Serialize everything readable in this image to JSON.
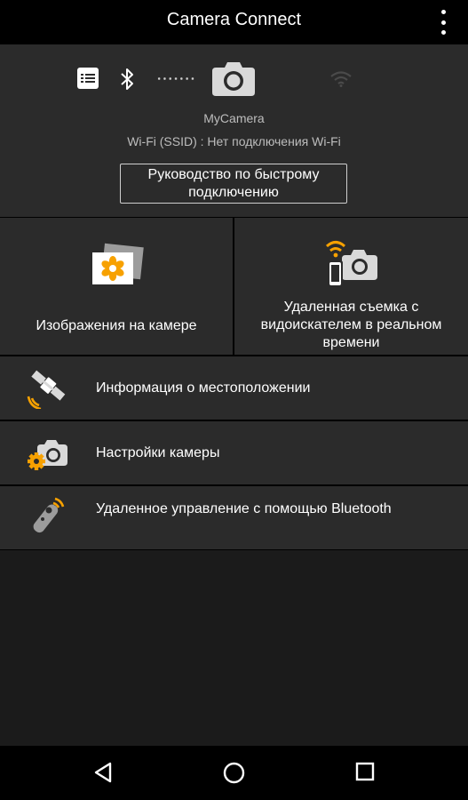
{
  "appbar": {
    "title": "Camera Connect",
    "menu_icon": "overflow-menu-icon"
  },
  "status": {
    "list_icon": "list-icon",
    "bluetooth_icon": "bluetooth-icon",
    "connection_dots_icon": "dotted-connection-icon",
    "camera_icon": "camera-icon",
    "wifi_icon": "wifi-icon",
    "camera_name": "MyCamera",
    "ssid_text": "Wi-Fi (SSID) :  Нет подключения Wi-Fi",
    "guide_button": "Руководство по быстрому подключению"
  },
  "tiles": {
    "images": {
      "label": "Изображения на камере",
      "icon": "flower-photos-icon"
    },
    "remote_shooting": {
      "label": "Удаленная съемка с видоискателем в реальном времени",
      "icon": "phone-camera-wifi-icon"
    }
  },
  "rows": [
    {
      "label": "Информация о местоположении",
      "icon": "satellite-icon"
    },
    {
      "label": "Настройки камеры",
      "icon": "camera-gear-icon"
    },
    {
      "label": "Удаленное управление с помощью Bluetooth",
      "icon": "remote-control-icon"
    }
  ],
  "navbar": {
    "back_icon": "back-triangle-icon",
    "home_icon": "home-circle-icon",
    "recents_icon": "recents-square-icon"
  },
  "colors": {
    "accent": "#f7a100",
    "panel": "#2b2b2b",
    "background": "#1b1b1b",
    "bar": "#000000"
  }
}
